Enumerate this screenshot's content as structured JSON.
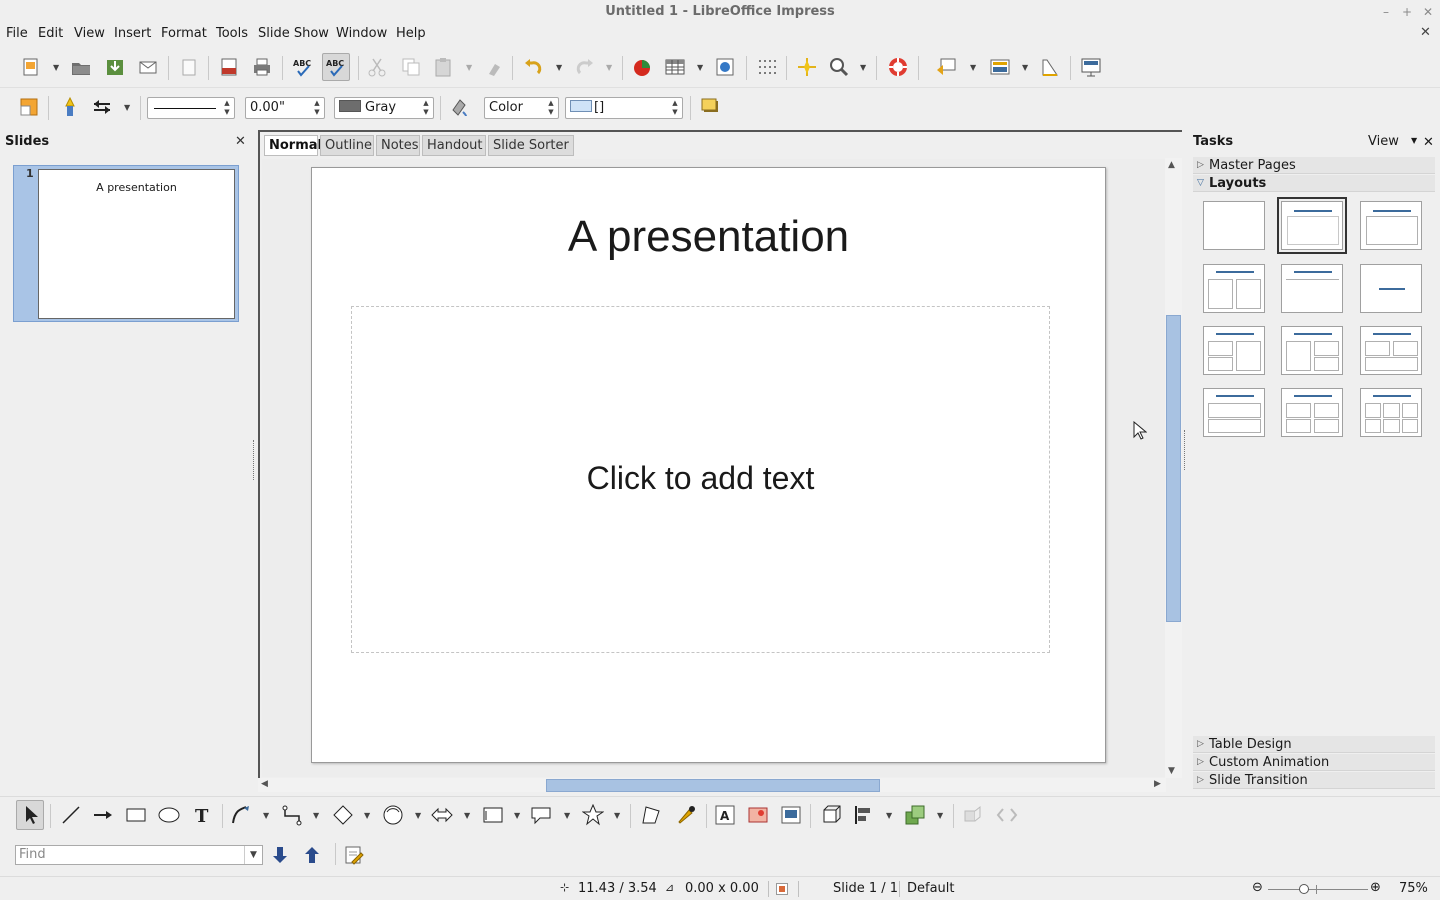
{
  "window": {
    "title": "Untitled 1 - LibreOffice Impress",
    "controls": {
      "minimize": "–",
      "maximize": "+",
      "close": "✕"
    }
  },
  "menubar": {
    "items": [
      {
        "label": "File"
      },
      {
        "label": "Edit"
      },
      {
        "label": "View"
      },
      {
        "label": "Insert"
      },
      {
        "label": "Format"
      },
      {
        "label": "Tools"
      },
      {
        "label": "Slide Show"
      },
      {
        "label": "Window"
      },
      {
        "label": "Help"
      }
    ]
  },
  "line_toolbar": {
    "line_width": "0.00\"",
    "line_color": "Gray",
    "area_style": "Color",
    "area_fill": "[]"
  },
  "slides_panel": {
    "title": "Slides",
    "close": "✕",
    "slides": [
      {
        "number": "1",
        "title": "A presentation"
      }
    ]
  },
  "view_tabs": [
    {
      "label": "Normal",
      "active": true
    },
    {
      "label": "Outline",
      "active": false
    },
    {
      "label": "Notes",
      "active": false
    },
    {
      "label": "Handout",
      "active": false
    },
    {
      "label": "Slide Sorter",
      "active": false
    }
  ],
  "slide": {
    "title": "A presentation",
    "placeholder": "Click to add text"
  },
  "tasks_panel": {
    "title": "Tasks",
    "view_label": "View",
    "close": "✕",
    "sections": {
      "master_pages": "Master Pages",
      "layouts": "Layouts",
      "table_design": "Table Design",
      "custom_animation": "Custom Animation",
      "slide_transition": "Slide Transition"
    },
    "selected_layout": "title-content"
  },
  "find": {
    "placeholder": "Find"
  },
  "statusbar": {
    "position": "11.43 / 3.54",
    "size": "0.00 x 0.00",
    "slide": "Slide 1 / 1",
    "master": "Default",
    "zoom": "75%"
  },
  "colors": {
    "accent": "#3c6b9c",
    "selection": "#a9c4e6",
    "scroll_thumb": "#a8c2e2"
  }
}
